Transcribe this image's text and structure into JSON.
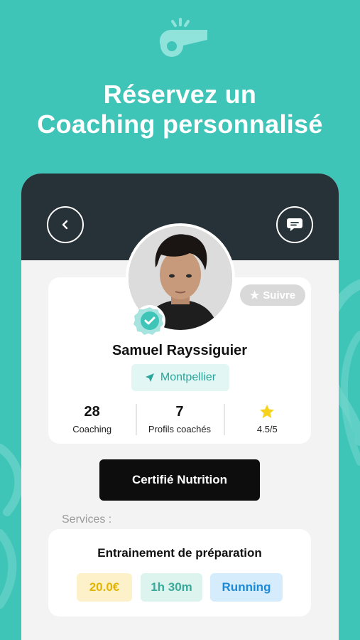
{
  "hero": {
    "icon": "whistle-icon",
    "headline_line1": "Réservez un",
    "headline_line2": "Coaching personnalisé"
  },
  "header": {
    "back_icon": "chevron-left-icon",
    "chat_icon": "chat-bubble-icon"
  },
  "profile": {
    "name": "Samuel Rayssiguier",
    "location": "Montpellier",
    "follow_label": "Suivre",
    "verified_icon": "check-badge-icon",
    "stats": [
      {
        "value": "28",
        "label": "Coaching"
      },
      {
        "value": "7",
        "label": "Profils coachés"
      },
      {
        "value": "",
        "label": "4.5/5",
        "icon": "star-icon"
      }
    ]
  },
  "certification": {
    "label": "Certifié Nutrition"
  },
  "services": {
    "label": "Services :",
    "items": [
      {
        "title": "Entrainement de préparation",
        "price": "20.0€",
        "duration": "1h 30m",
        "sport": "Running"
      }
    ]
  },
  "colors": {
    "background": "#3fc4b8",
    "header": "#263238",
    "accent": "#2aa59b",
    "star": "#f7d21c"
  }
}
